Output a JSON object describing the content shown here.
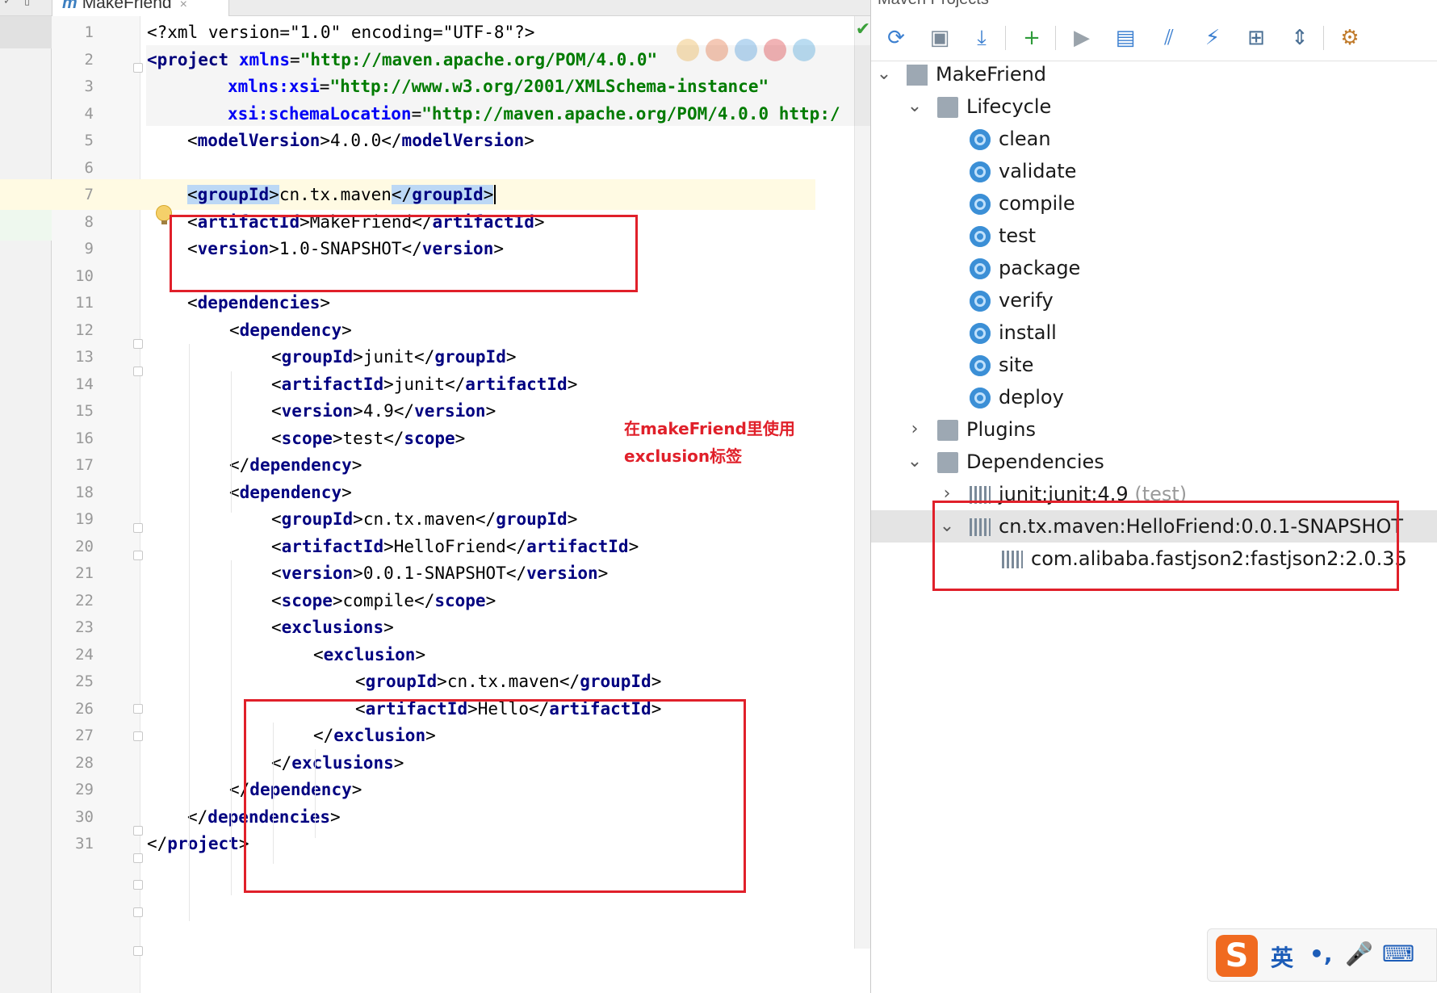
{
  "editor": {
    "tab_label": "MakeFriend",
    "tab_icon": "m",
    "close_glyph": "×",
    "lines": [
      {
        "n": "1"
      },
      {
        "n": "2"
      },
      {
        "n": "3"
      },
      {
        "n": "4"
      },
      {
        "n": "5"
      },
      {
        "n": "6"
      },
      {
        "n": "7"
      },
      {
        "n": "8"
      },
      {
        "n": "9"
      },
      {
        "n": "10"
      },
      {
        "n": "11"
      },
      {
        "n": "12"
      },
      {
        "n": "13"
      },
      {
        "n": "14"
      },
      {
        "n": "15"
      },
      {
        "n": "16"
      },
      {
        "n": "17"
      },
      {
        "n": "18"
      },
      {
        "n": "19"
      },
      {
        "n": "20"
      },
      {
        "n": "21"
      },
      {
        "n": "22"
      },
      {
        "n": "23"
      },
      {
        "n": "24"
      },
      {
        "n": "25"
      },
      {
        "n": "26"
      },
      {
        "n": "27"
      },
      {
        "n": "28"
      },
      {
        "n": "29"
      },
      {
        "n": "30"
      },
      {
        "n": "31"
      }
    ],
    "code": {
      "l1_decl": "<?xml version=\"1.0\" encoding=\"UTF-8\"?>",
      "l2_open": "<project",
      "l2_attr": "xmlns",
      "l2_val": "\"http://maven.apache.org/POM/4.0.0\"",
      "l3_attr": "xmlns:xsi",
      "l3_val": "\"http://www.w3.org/2001/XMLSchema-instance\"",
      "l4_attr": "xsi:schemaLocation",
      "l4_val": "\"http://maven.apache.org/POM/4.0.0 http:/",
      "model_version": "4.0.0",
      "group_id": "cn.tx.maven",
      "artifact_id": "MakeFriend",
      "version": "1.0-SNAPSHOT",
      "dep1_group": "junit",
      "dep1_artifact": "junit",
      "dep1_version": "4.9",
      "dep1_scope": "test",
      "dep2_group": "cn.tx.maven",
      "dep2_artifact": "HelloFriend",
      "dep2_version": "0.0.1-SNAPSHOT",
      "dep2_scope": "compile",
      "excl_group": "cn.tx.maven",
      "excl_artifact": "Hello"
    },
    "annotation_line1": "在makeFriend里使用",
    "annotation_line2": "exclusion标签",
    "status_check": "✔"
  },
  "maven_panel": {
    "title": "Maven Projects",
    "tree": {
      "project": "MakeFriend",
      "lifecycle": "Lifecycle",
      "phases": [
        "clean",
        "validate",
        "compile",
        "test",
        "package",
        "verify",
        "install",
        "site",
        "deploy"
      ],
      "plugins": "Plugins",
      "dependencies": "Dependencies",
      "dep_junit": "junit:junit:4.9",
      "dep_junit_scope": "(test)",
      "dep_hellofriend": "cn.tx.maven:HelloFriend:0.0.1-SNAPSHOT",
      "dep_fastjson": "com.alibaba.fastjson2:fastjson2:2.0.35"
    },
    "toolbar": [
      {
        "name": "reimport-icon",
        "glyph": "⟳",
        "color": "#3b7fd0"
      },
      {
        "name": "generate-sources-icon",
        "glyph": "▣",
        "color": "#7b8a99"
      },
      {
        "name": "download-icon",
        "glyph": "⤓",
        "color": "#3b7fd0"
      },
      {
        "name": "add-icon",
        "glyph": "+",
        "color": "#2e9b3a"
      },
      {
        "name": "run-icon",
        "glyph": "▶",
        "color": "#9aa3ab"
      },
      {
        "name": "run-config-icon",
        "glyph": "▤",
        "color": "#3b7fd0"
      },
      {
        "name": "toggle-offline-icon",
        "glyph": "⫽",
        "color": "#3b7fd0"
      },
      {
        "name": "skip-tests-icon",
        "glyph": "⚡",
        "color": "#3b7fd0"
      },
      {
        "name": "show-dependencies-icon",
        "glyph": "⊞",
        "color": "#4a6f94"
      },
      {
        "name": "collapse-all-icon",
        "glyph": "⇕",
        "color": "#4a6f94"
      },
      {
        "name": "settings-icon",
        "glyph": "⚙",
        "color": "#c07a2a"
      }
    ]
  },
  "ime": {
    "logo": "S",
    "lang": "英",
    "punct": "•,",
    "mic": "🎤",
    "keyboard": "⌨"
  },
  "left_strip": {
    "glyph_a": "✓",
    "glyph_b": "▯"
  },
  "colors": {
    "annotation": "#e0202a",
    "tag": "#000080",
    "attr": "#0000ff",
    "string": "#008000"
  }
}
